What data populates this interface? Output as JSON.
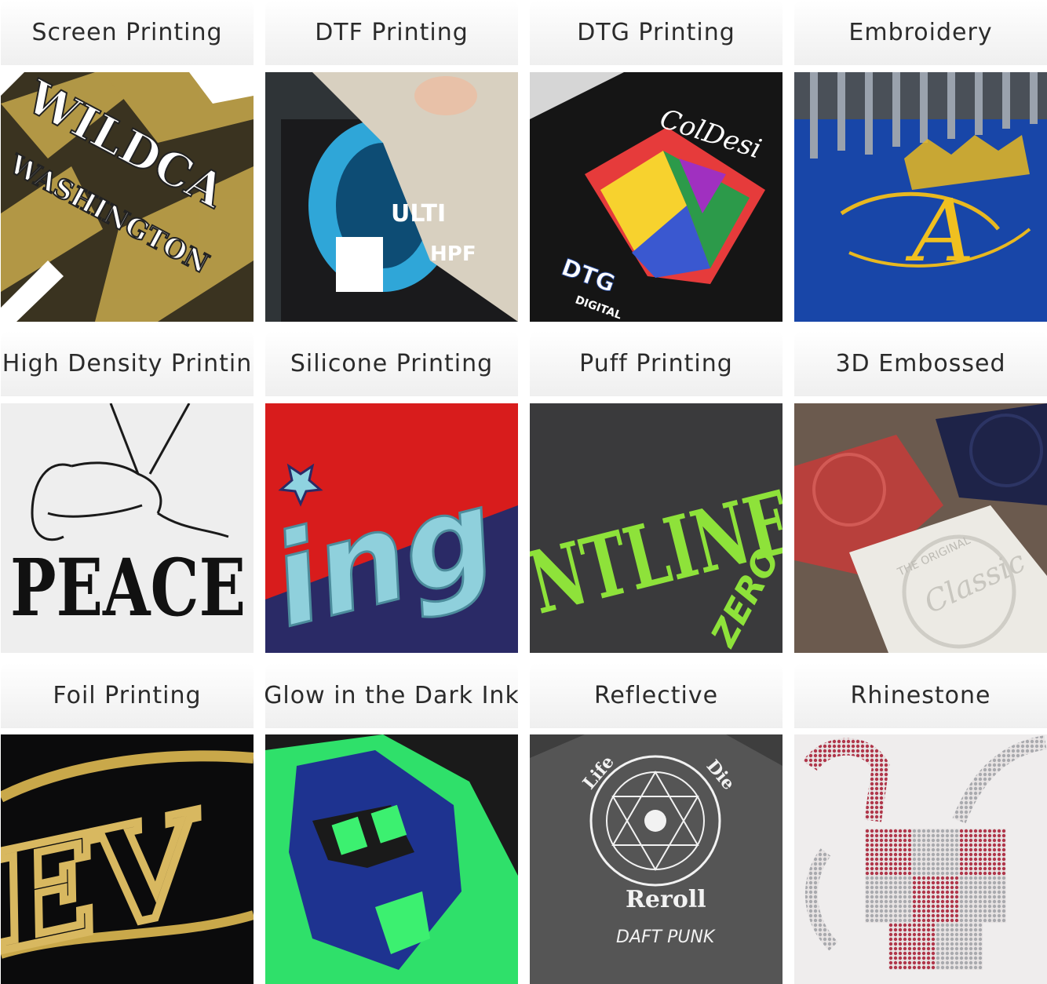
{
  "tiles": [
    {
      "label": "Screen Printing",
      "image_text": [
        "WASHINGTON",
        "WILDCA"
      ]
    },
    {
      "label": "DTF Printing",
      "image_text": [
        "ULTI",
        "HPF"
      ]
    },
    {
      "label": "DTG Printing",
      "image_text": [
        "ColDesi",
        "DTG",
        "DIGITAL"
      ]
    },
    {
      "label": "Embroidery",
      "image_text": [
        "A"
      ]
    },
    {
      "label": "High Density Printin",
      "image_text": [
        "PEACE"
      ]
    },
    {
      "label": "Silicone Printing",
      "image_text": [
        "ing"
      ]
    },
    {
      "label": "Puff Printing",
      "image_text": [
        "NTLINE",
        "ZERO"
      ]
    },
    {
      "label": "3D Embossed",
      "image_text": [
        "Classic",
        "THE ORIGINAL"
      ]
    },
    {
      "label": "Foil Printing",
      "image_text": [
        "EV"
      ]
    },
    {
      "label": "Glow in the Dark Ink",
      "image_text": []
    },
    {
      "label": "Reflective",
      "image_text": [
        "Life",
        "Die",
        "Reroll",
        "DAFT PUNK"
      ]
    },
    {
      "label": "Rhinestone",
      "image_text": []
    }
  ],
  "colors": {
    "label_bg": "#efefef",
    "label_text": "#2b2b2b"
  }
}
